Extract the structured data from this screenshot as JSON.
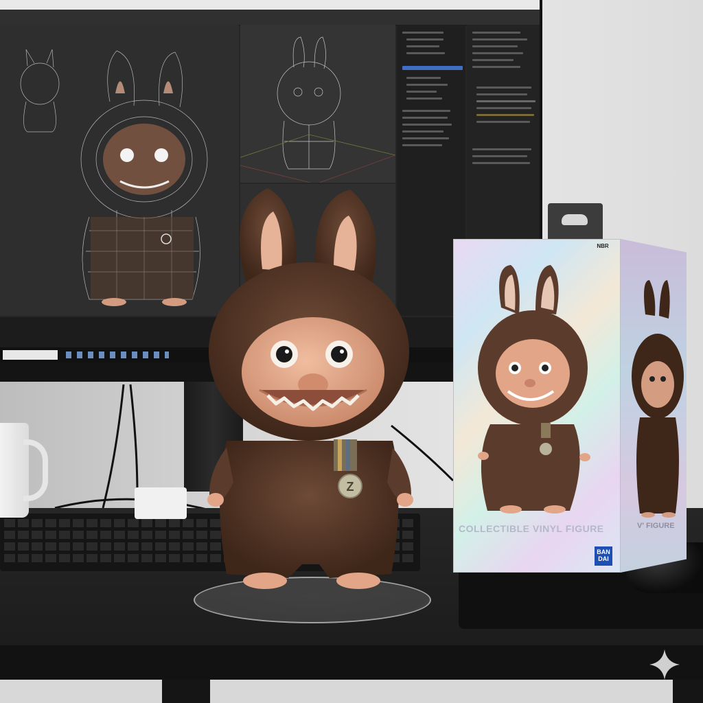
{
  "box": {
    "title": "COLLECTIBLE VINYL FIGURE",
    "side_title": "V' FIGURE",
    "brand_line1": "BAN",
    "brand_line2": "DAI",
    "badge": "NBR"
  },
  "figure": {
    "medal_letter": "Z"
  },
  "colors": {
    "fur": "#5a3b2c",
    "fur_dark": "#3e2619",
    "skin": "#e2a587",
    "desk": "#1e1e1e",
    "screen_bg": "#262626",
    "wireframe": "#c8c8c8"
  },
  "icons": [
    "sparkle-icon",
    "medal-icon"
  ]
}
